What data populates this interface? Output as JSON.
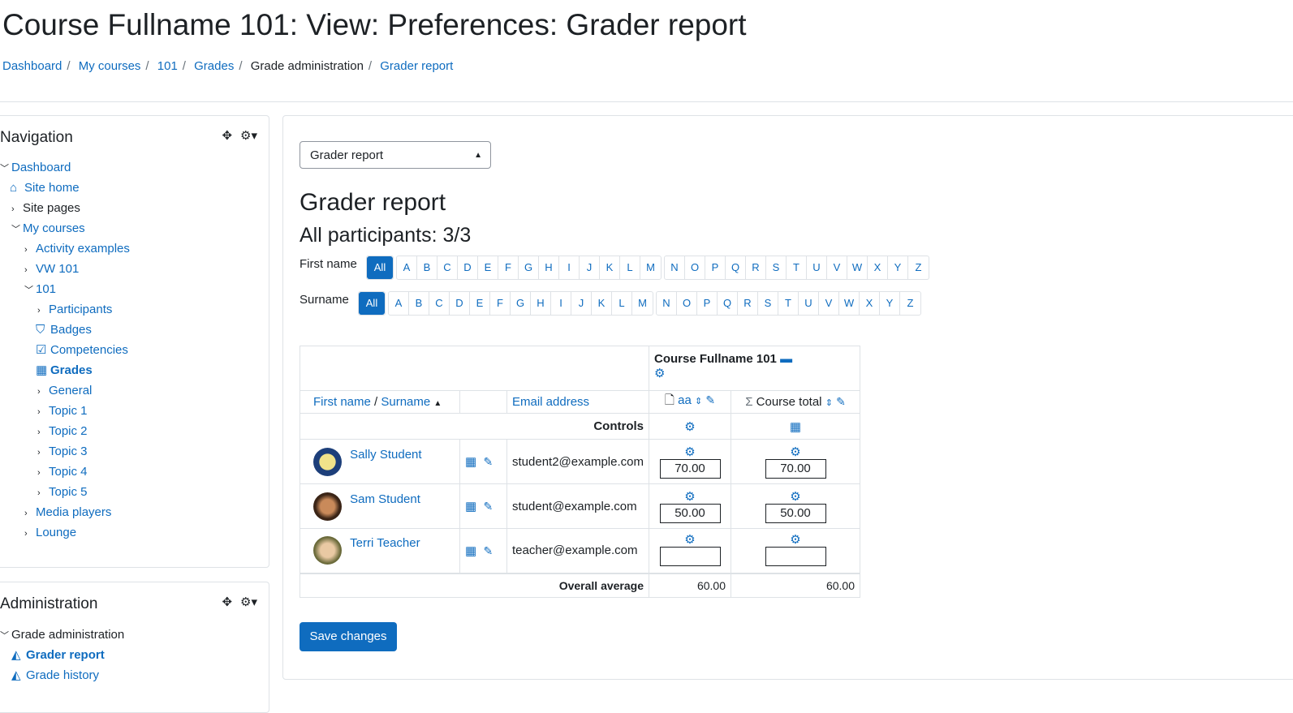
{
  "page": {
    "title": "Course Fullname 101: View: Preferences: Grader report",
    "breadcrumb": [
      "Dashboard",
      "My courses",
      "101",
      "Grades",
      "Grade administration",
      "Grader report"
    ]
  },
  "nav_block": {
    "title": "Navigation",
    "items": [
      "Dashboard",
      "Site home",
      "Site pages",
      "My courses",
      "Activity examples",
      "VW 101",
      "101",
      "Participants",
      "Badges",
      "Competencies",
      "Grades",
      "General",
      "Topic 1",
      "Topic 2",
      "Topic 3",
      "Topic 4",
      "Topic 5",
      "Media players",
      "Lounge"
    ]
  },
  "admin_block": {
    "title": "Administration",
    "items": [
      "Grade administration",
      "Grader report",
      "Grade history"
    ]
  },
  "main": {
    "select_value": "Grader report",
    "heading": "Grader report",
    "participants": "All participants: 3/3",
    "firstname_label": "First name",
    "surname_label": "Surname",
    "all_label": "All",
    "letters": [
      "A",
      "B",
      "C",
      "D",
      "E",
      "F",
      "G",
      "H",
      "I",
      "J",
      "K",
      "L",
      "M",
      "N",
      "O",
      "P",
      "Q",
      "R",
      "S",
      "T",
      "U",
      "V",
      "W",
      "X",
      "Y",
      "Z"
    ],
    "save_label": "Save changes"
  },
  "table": {
    "course_header": "Course Fullname 101",
    "col_firstname": "First name",
    "col_slash": " / ",
    "col_surname": "Surname",
    "col_email": "Email address",
    "col_item": "aa",
    "col_total": "Course total",
    "controls_label": "Controls",
    "rows": [
      {
        "name": "Sally Student",
        "email": "student2@example.com",
        "grade": "70.00",
        "total": "70.00"
      },
      {
        "name": "Sam Student",
        "email": "student@example.com",
        "grade": "50.00",
        "total": "50.00"
      },
      {
        "name": "Terri Teacher",
        "email": "teacher@example.com",
        "grade": "",
        "total": ""
      }
    ],
    "overall_label": "Overall average",
    "overall_item": "60.00",
    "overall_total": "60.00"
  },
  "colors": {
    "link": "#0f6cbf",
    "border": "#dee2e6",
    "primary": "#0f6cbf"
  }
}
